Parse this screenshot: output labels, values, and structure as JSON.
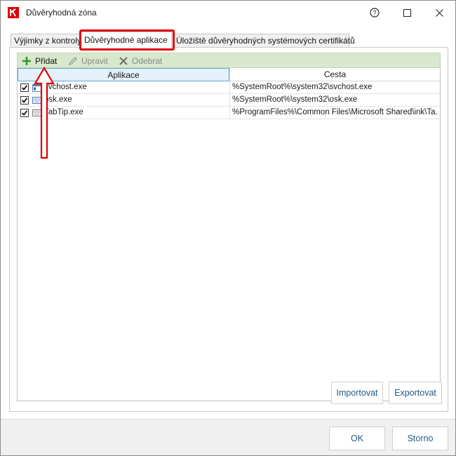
{
  "window": {
    "title": "Důvěryhodná zóna",
    "controls": {
      "help": "?",
      "maximize": "maximize-icon",
      "close": "close-icon"
    }
  },
  "tabs": [
    {
      "label": "Výjimky z kontroly",
      "active": false
    },
    {
      "label": "Důvěryhodné aplikace",
      "active": true
    },
    {
      "label": "Úložiště důvěryhodných systémových certifikátů",
      "active": false
    }
  ],
  "toolbar": {
    "add_label": "Přidat",
    "edit_label": "Upravit",
    "remove_label": "Odebrat"
  },
  "table": {
    "columns": [
      "Aplikace",
      "Cesta"
    ],
    "rows": [
      {
        "checked": true,
        "icon": "window-app-icon",
        "name": "svchost.exe",
        "path": "%SystemRoot%\\system32\\svchost.exe"
      },
      {
        "checked": true,
        "icon": "keyboard-icon",
        "name": "osk.exe",
        "path": "%SystemRoot%\\system32\\osk.exe"
      },
      {
        "checked": true,
        "icon": "keyboard-icon",
        "name": "TabTip.exe",
        "path": "%ProgramFiles%\\Common Files\\Microsoft Shared\\ink\\Ta..."
      }
    ]
  },
  "panel_buttons": {
    "import": "Importovat",
    "export": "Exportovat"
  },
  "footer": {
    "ok": "OK",
    "cancel": "Storno"
  },
  "colors": {
    "toolbar_bg": "#d8e8cc",
    "highlight": "#e00000",
    "button_text": "#1f5a87",
    "header_selected": "#e4f0fa"
  }
}
